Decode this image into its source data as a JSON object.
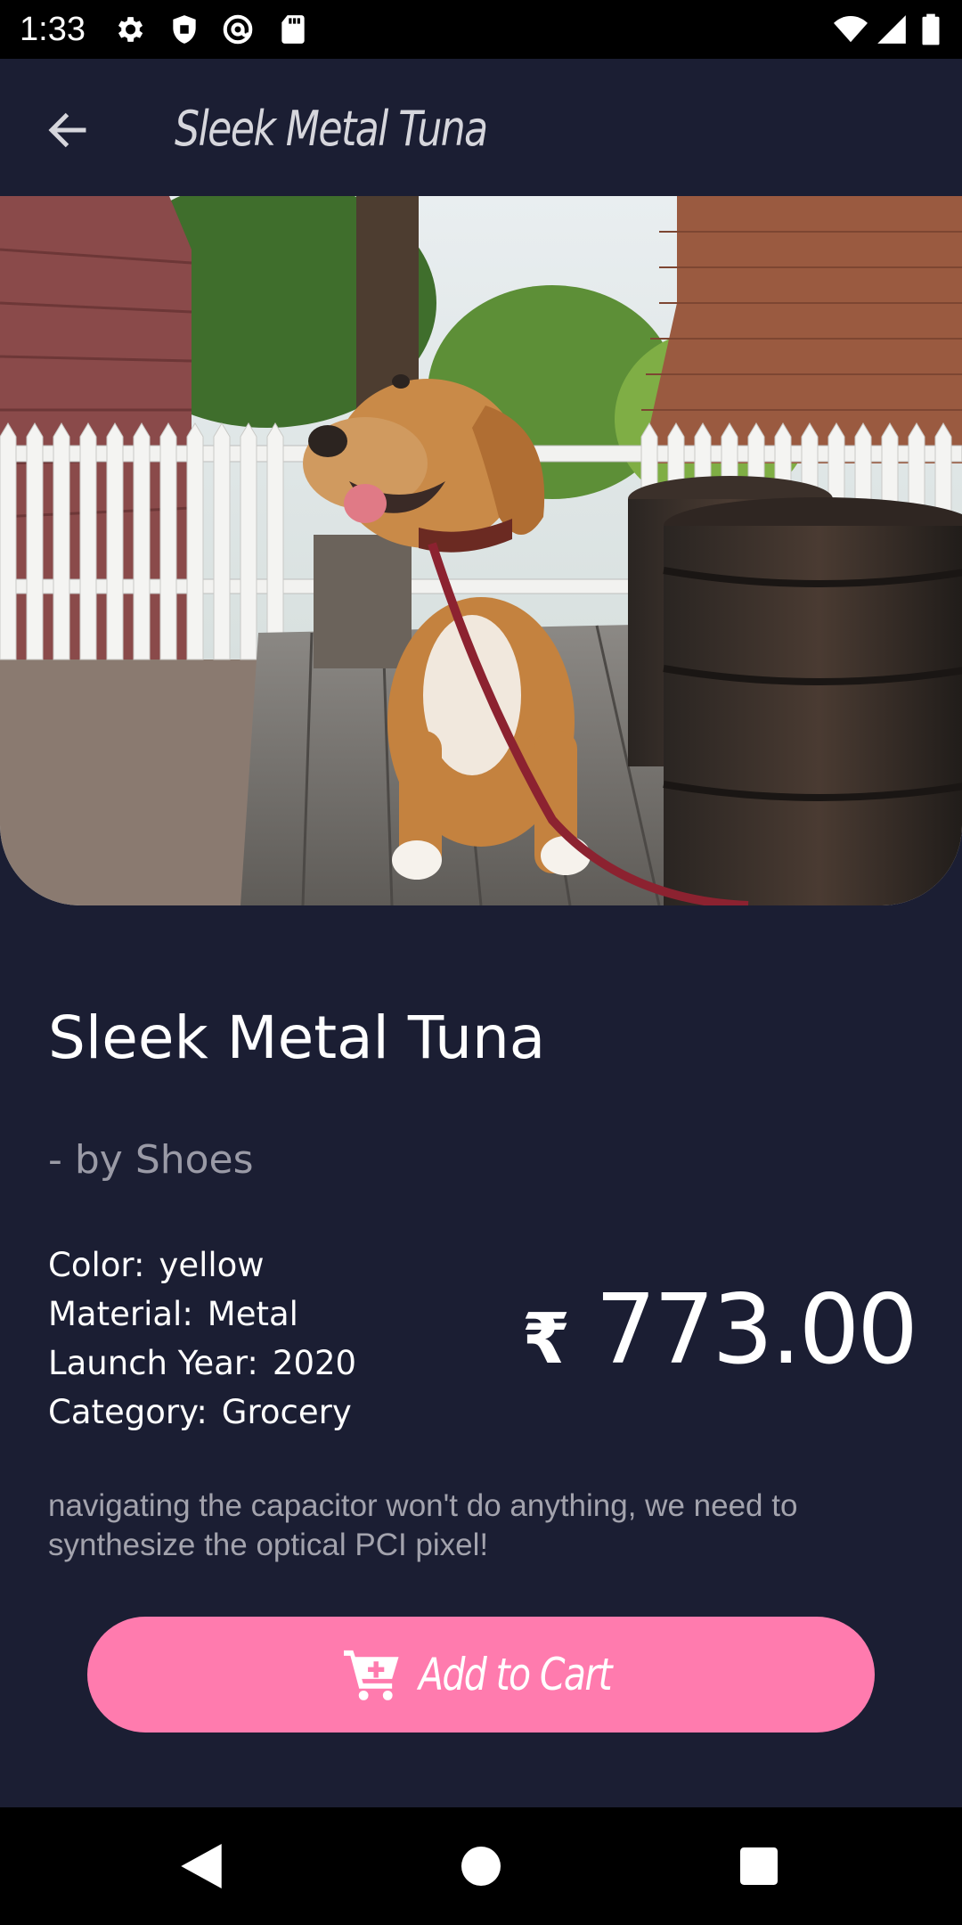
{
  "status_bar": {
    "time": "1:33",
    "icons": [
      "gear-icon",
      "shield-icon",
      "at-sign-icon",
      "sd-card-icon",
      "wifi-icon",
      "signal-icon",
      "battery-icon"
    ]
  },
  "app_bar": {
    "title": "Sleek Metal Tuna",
    "back_icon": "arrow-left-icon"
  },
  "product": {
    "name": "Sleek Metal Tuna",
    "brand": "- by Shoes",
    "specs": [
      {
        "label": "Color:",
        "value": "yellow"
      },
      {
        "label": "Material:",
        "value": "Metal"
      },
      {
        "label": "Launch Year:",
        "value": "2020"
      },
      {
        "label": "Category:",
        "value": "Grocery"
      }
    ],
    "price_symbol": "₹",
    "price": "773.00",
    "description": "navigating the capacitor won't do anything, we need to synthesize the optical PCI pixel!",
    "image_alt": "dog photo"
  },
  "actions": {
    "add_to_cart_label": "Add to Cart",
    "add_to_cart_icon": "cart-plus-icon"
  },
  "nav_bar": {
    "icons": [
      "back-triangle-icon",
      "home-circle-icon",
      "recents-square-icon"
    ]
  },
  "colors": {
    "background": "#1b1e33",
    "accent": "#ff7bae",
    "text_primary": "#ffffff",
    "text_secondary": "#9a9aa6"
  }
}
